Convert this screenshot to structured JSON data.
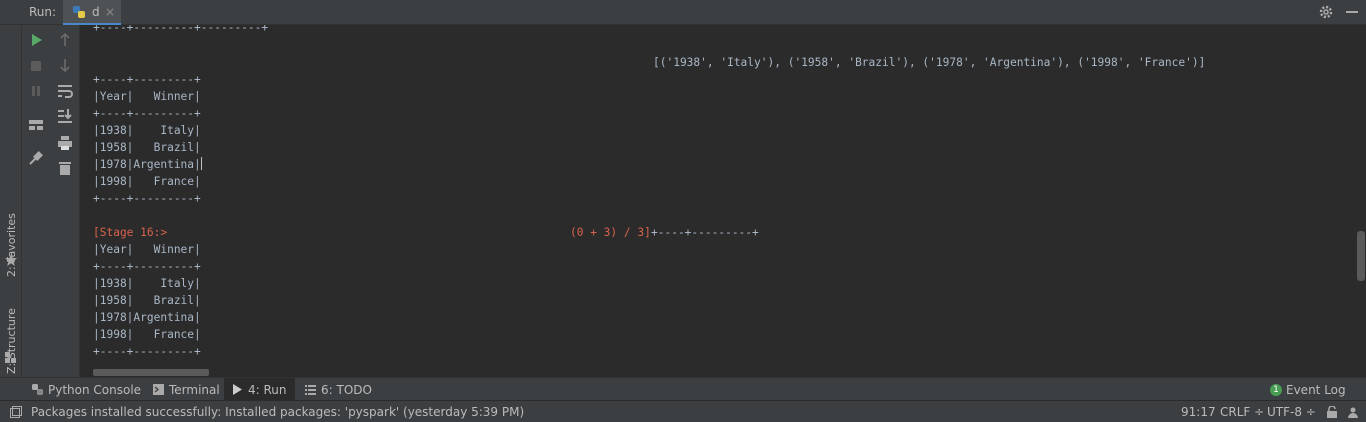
{
  "run_panel": {
    "label": "Run:",
    "tab": {
      "title": "d",
      "close": "×",
      "icon": "python-file-icon"
    },
    "settings_icon": "gear-icon",
    "minimize_icon": "minimize-icon"
  },
  "side_stripe": {
    "favorites": "2: Favorites",
    "structure": "Z: Structure"
  },
  "toolbar": {
    "buttons": [
      "run-icon",
      "stop-icon",
      "pause-icon",
      "layout-icon",
      "pin-icon",
      "up-arrow-icon",
      "down-arrow-icon",
      "soft-wrap-icon",
      "scroll-to-end-icon",
      "print-icon",
      "trash-icon"
    ],
    "run_color": "#59a869"
  },
  "console": {
    "lines": [
      "+----+---------+---------+",
      "[('1938', 'Italy'), ('1958', 'Brazil'), ('1978', 'Argentina'), ('1998', 'France')]",
      "+----+---------+",
      "|Year|   Winner|",
      "+----+---------+",
      "|1938|    Italy|",
      "|1958|   Brazil|",
      "|1978|Argentina|",
      "|1998|   France|",
      "+----+---------+",
      "[Stage 16:>",
      "(0 + 3) / 3]",
      "+----+---------+",
      "|Year|   Winner|",
      "+----+---------+",
      "|1938|    Italy|",
      "|1958|   Brazil|",
      "|1978|Argentina|",
      "|1998|   France|",
      "+----+---------+"
    ],
    "stage_color": "#d9634c",
    "text_color": "#a9b7c6"
  },
  "bottom_tabs": {
    "python_console": "Python Console",
    "terminal": "Terminal",
    "run": "4: Run",
    "todo": "6: TODO",
    "event_log": "Event Log",
    "event_count": "1"
  },
  "status_bar": {
    "message": "Packages installed successfully: Installed packages: 'pyspark' (yesterday 5:39 PM)",
    "position": "91:17",
    "line_sep": "CRLF ÷",
    "encoding": "UTF-8 ÷"
  }
}
